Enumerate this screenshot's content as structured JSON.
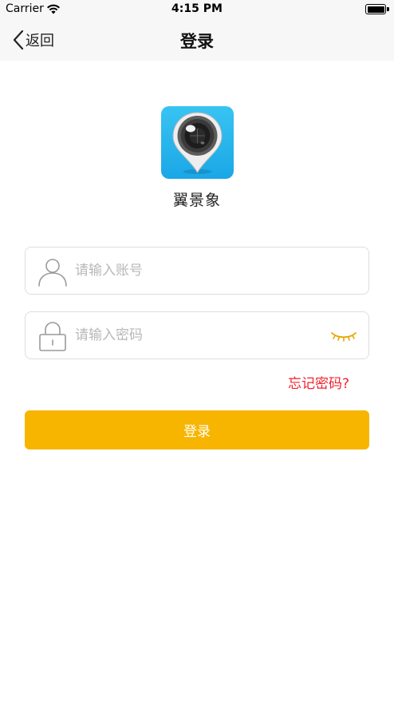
{
  "status_bar": {
    "carrier": "Carrier",
    "time": "4:15 PM"
  },
  "nav": {
    "back_label": "返回",
    "title": "登录"
  },
  "app": {
    "name": "翼景象"
  },
  "form": {
    "account_placeholder": "请输入账号",
    "password_placeholder": "请输入密码",
    "forgot_label": "忘记密码?",
    "login_label": "登录"
  },
  "colors": {
    "accent": "#f7b500",
    "link": "#f2222e",
    "logo_bg": "#1aa7e6"
  },
  "icons": {
    "back": "chevron-left-icon",
    "account": "user-icon",
    "password": "lock-icon",
    "toggle": "eye-closed-icon",
    "logo": "camera-pin-icon"
  }
}
